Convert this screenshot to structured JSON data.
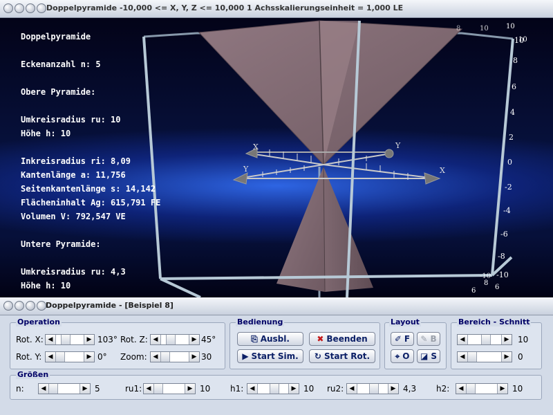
{
  "window_top": {
    "title": "Doppelpyramide   -10,000 <= X, Y, Z <= 10,000    1 Achsskalierungseinheit = 1,000 LE"
  },
  "window_bottom": {
    "title": "Doppelpyramide - [Beispiel 8]"
  },
  "info": {
    "lines": [
      "Doppelpyramide",
      "Eckenanzahl n: 5",
      "Obere Pyramide:",
      "Umkreisradius ru: 10",
      "Höhe h: 10",
      "Inkreisradius ri: 8,09",
      "Kantenlänge a: 11,756",
      "Seitenkantenlänge s: 14,142",
      "Flächeninhalt Ag: 615,791 FE",
      "Volumen V: 792,547 VE",
      "Untere Pyramide:",
      "Umkreisradius ru: 4,3",
      "Höhe h: 10"
    ]
  },
  "axes": {
    "x_label": "X",
    "y_label": "Y",
    "z_ticks": [
      "10",
      "8",
      "6",
      "4",
      "2",
      "0",
      "-2",
      "-4",
      "-6",
      "-8",
      "-10"
    ],
    "corner_labels": [
      "10",
      "10",
      "10",
      "8",
      "-10",
      "6",
      "8",
      "6"
    ]
  },
  "colors": {
    "pyramid_face": "#8a6f78",
    "frame": "#b7c9d6",
    "panel": "#d3dbe8",
    "label_blue": "#000066"
  },
  "panel": {
    "operation": {
      "label": "Operation",
      "rot_x_label": "Rot. X:",
      "rot_x_value": "103°",
      "rot_x": 0.3,
      "rot_y_label": "Rot. Y:",
      "rot_y_value": "0°",
      "rot_y": 0.0,
      "rot_z_label": "Rot. Z:",
      "rot_z_value": "45°",
      "rot_z": 0.3,
      "zoom_label": "Zoom:",
      "zoom_value": "30",
      "zoom": 0.0
    },
    "bedienung": {
      "label": "Bedienung",
      "ausbl": "Ausbl.",
      "beenden": "Beenden",
      "start_sim": "Start Sim.",
      "start_rot": "Start Rot."
    },
    "layout": {
      "label": "Layout",
      "f": "F",
      "b": "B",
      "o": "O",
      "s": "S"
    },
    "bereich": {
      "label": "Bereich - Schnitt",
      "value1": "10",
      "value2": "0",
      "slider1": 0.55,
      "slider2": 0.0
    },
    "groessen": {
      "label": "Größen",
      "n_label": "n:",
      "n_value": "5",
      "n": 0.0,
      "ru1_label": "ru1:",
      "ru1_value": "10",
      "ru1": 0.0,
      "h1_label": "h1:",
      "h1_value": "10",
      "h1": 0.55,
      "ru2_label": "ru2:",
      "ru2_value": "4,3",
      "ru2": 0.55,
      "h2_label": "h2:",
      "h2_value": "10",
      "h2": 0.0
    }
  }
}
